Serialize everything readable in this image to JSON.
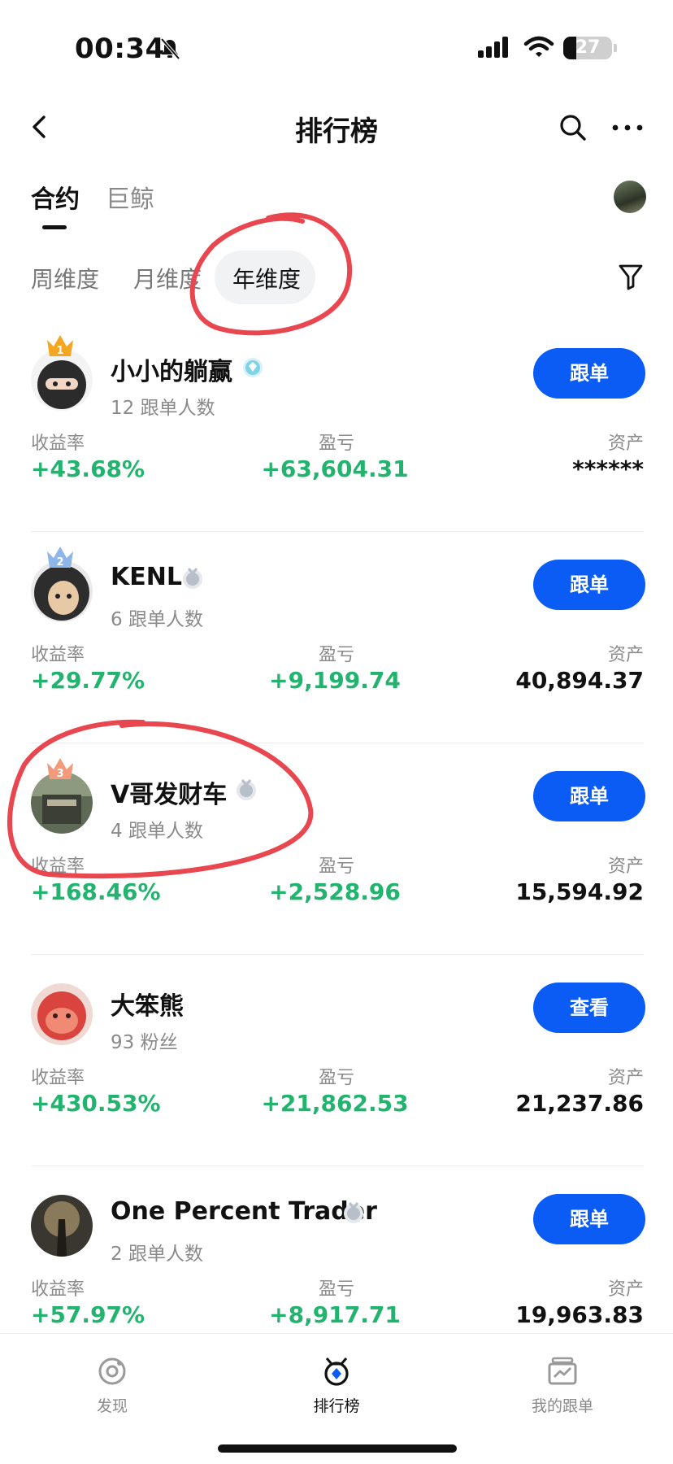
{
  "status_bar": {
    "time": "00:34",
    "battery": "27"
  },
  "header": {
    "title": "排行榜"
  },
  "tabs": [
    {
      "label": "合约",
      "active": true
    },
    {
      "label": "巨鲸",
      "active": false
    }
  ],
  "periods": [
    {
      "label": "周维度"
    },
    {
      "label": "月维度"
    },
    {
      "label": "年维度",
      "active": true
    }
  ],
  "columns": {
    "rate": "收益率",
    "pnl": "盈亏",
    "asset": "资产"
  },
  "traders": [
    {
      "rank": "1",
      "name": "小小的躺赢",
      "followers": "12 跟单人数",
      "button": "跟单",
      "rate": "+43.68%",
      "pnl": "+63,604.31",
      "asset": "******"
    },
    {
      "rank": "2",
      "name": "KENL",
      "followers": "6 跟单人数",
      "button": "跟单",
      "rate": "+29.77%",
      "pnl": "+9,199.74",
      "asset": "40,894.37"
    },
    {
      "rank": "3",
      "name": "V哥发财车",
      "followers": "4 跟单人数",
      "button": "跟单",
      "rate": "+168.46%",
      "pnl": "+2,528.96",
      "asset": "15,594.92"
    },
    {
      "rank": "",
      "name": "大笨熊",
      "followers": "93 粉丝",
      "button": "查看",
      "rate": "+430.53%",
      "pnl": "+21,862.53",
      "asset": "21,237.86"
    },
    {
      "rank": "",
      "name": "One Percent Trader",
      "followers": "2 跟单人数",
      "button": "跟单",
      "rate": "+57.97%",
      "pnl": "+8,917.71",
      "asset": "19,963.83"
    }
  ],
  "bottom_nav": [
    {
      "label": "发现",
      "icon": "discover-icon"
    },
    {
      "label": "排行榜",
      "icon": "leaderboard-icon",
      "active": true
    },
    {
      "label": "我的跟单",
      "icon": "copy-trade-icon"
    }
  ],
  "colors": {
    "accent": "#0a5cf5",
    "positive": "#22b46e",
    "annotation": "#e8474f"
  }
}
